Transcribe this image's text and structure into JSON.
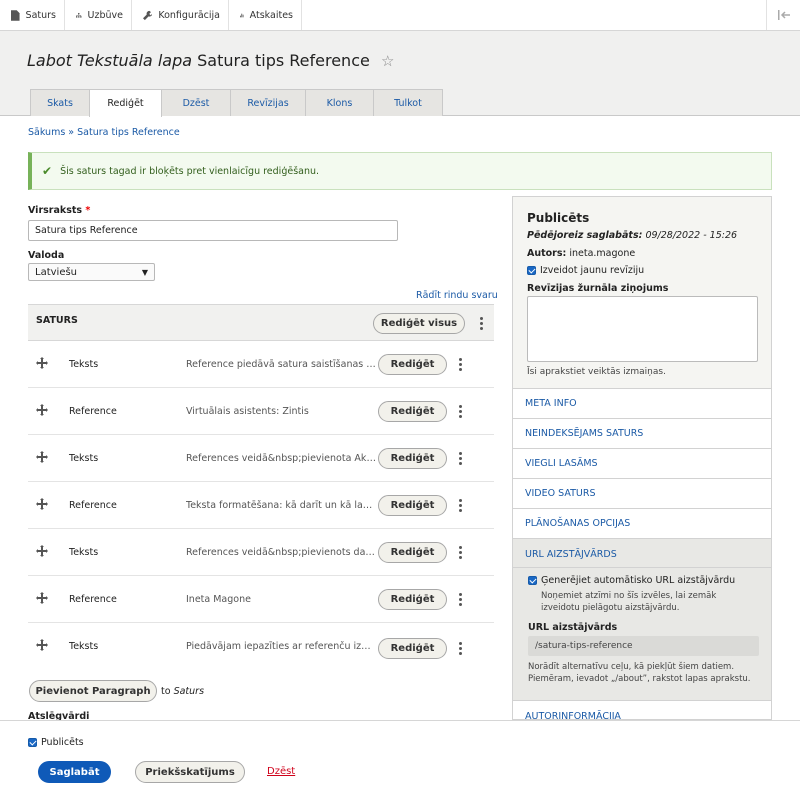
{
  "toolbar": {
    "items": [
      {
        "label": "Saturs",
        "icon": "file-icon"
      },
      {
        "label": "Uzbūve",
        "icon": "sitemap-icon"
      },
      {
        "label": "Konfigurācija",
        "icon": "wrench-icon"
      },
      {
        "label": "Atskaites",
        "icon": "bar-chart-icon"
      }
    ],
    "collapse_icon": "collapse-sidebar-icon"
  },
  "header": {
    "title_italic": "Labot Tekstuāla lapa",
    "title_rest": "Satura tips Reference",
    "tabs": [
      "Skats",
      "Rediģēt",
      "Dzēst",
      "Revīzijas",
      "Klons",
      "Tulkot"
    ],
    "active_tab": "Rediģēt"
  },
  "breadcrumb": "Sākums » Satura tips Reference",
  "status_message": "Šis saturs tagad ir bloķēts pret vienlaicīgu rediģēšanu.",
  "form": {
    "title_label": "Virsraksts",
    "title_required_mark": "*",
    "title_value": "Satura tips Reference",
    "language_label": "Valoda",
    "language_value": "Latviešu",
    "row_weights_link": "Rādīt rindu svaru",
    "saturs_label": "SATURS",
    "edit_all_button": "Rediģēt visus",
    "paragraphs": [
      {
        "type": "Teksts",
        "summary": "Reference piedāvā satura saistīšanas u...",
        "button": "Rediģēt"
      },
      {
        "type": "Reference",
        "summary": "Virtuālais asistents: Zintis",
        "button": "Rediģēt"
      },
      {
        "type": "Teksts",
        "summary": "References veidā&nbsp;pievienota Akt...",
        "button": "Rediģēt"
      },
      {
        "type": "Reference",
        "summary": "Teksta formatēšana: kā darīt un kā lab...",
        "button": "Rediģēt"
      },
      {
        "type": "Teksts",
        "summary": "References veidā&nbsp;pievienots dar...",
        "button": "Rediģēt"
      },
      {
        "type": "Reference",
        "summary": "Ineta Magone",
        "button": "Rediģēt"
      },
      {
        "type": "Teksts",
        "summary": "Piedāvājam iepazīties ar referenču izm...",
        "button": "Rediģēt"
      }
    ],
    "add_paragraph_button": "Pievienot Paragraph",
    "add_to_text": "to",
    "add_to_target": "Saturs",
    "keywords_label": "Atslēgvārdi"
  },
  "sidebar": {
    "status_title": "Publicēts",
    "last_saved_label": "Pēdējoreiz saglabāts:",
    "last_saved_value": "09/28/2022 - 15:26",
    "author_label": "Autors:",
    "author_value": "ineta.magone",
    "new_revision_label": "Izveidot jaunu revīziju",
    "revision_log_label": "Revīzijas žurnāla ziņojums",
    "revision_log_help": "Īsi aprakstiet veiktās izmaiņas.",
    "sections": [
      "META INFO",
      "NEINDEKSĒJAMS SATURS",
      "VIEGLI LASĀMS",
      "VIDEO SATURS",
      "PLĀNOŠANAS OPCIJAS"
    ],
    "url_section": {
      "title": "URL AIZSTĀJVĀRDS",
      "generate_label": "Ģenerējiet automātisko URL aizstājvārdu",
      "generate_help_1": "Noņemiet atzīmi no šīs izvēles, lai zemāk",
      "generate_help_2": "izveidotu pielāgotu aizstājvārdu.",
      "alias_label": "URL aizstājvārds",
      "alias_value": "/satura-tips-reference",
      "alias_help_1": "Norādīt alternatīvu ceļu, kā piekļūt šiem datiem.",
      "alias_help_2": "Piemēram, ievadot „/about”, rakstot lapas aprakstu."
    },
    "author_info_section": "AUTORINFORMĀCIJA"
  },
  "footer": {
    "published_label": "Publicēts",
    "save_button": "Saglabāt",
    "preview_button": "Priekšskatījums",
    "delete_link": "Dzēst"
  },
  "colors": {
    "primary": "#0f5ab8",
    "link": "#1b5aa6",
    "status_border": "#77b259",
    "delete": "#d0021b"
  }
}
